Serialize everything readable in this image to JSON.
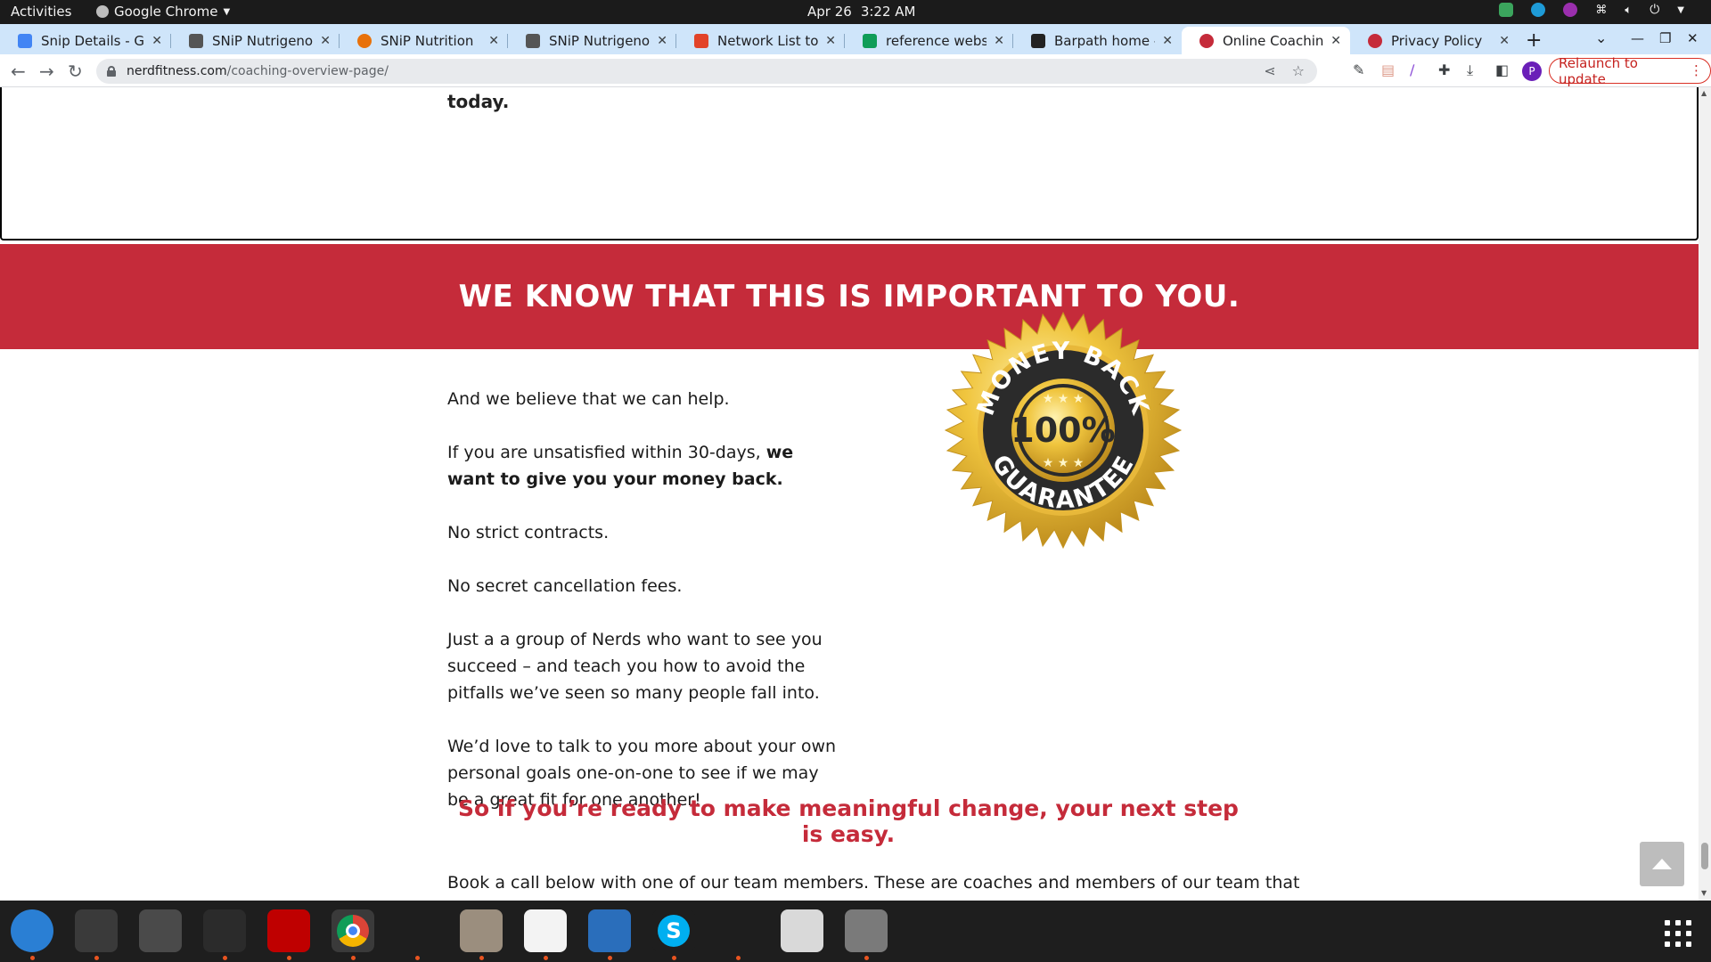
{
  "system": {
    "activities": "Activities",
    "app_name": "Google Chrome",
    "date": "Apr 26",
    "time": "3:22 AM"
  },
  "tabs": [
    {
      "label": "Snip Details - Goo",
      "color": "#4285f4"
    },
    {
      "label": "SNiP Nutrigenomi",
      "color": "#555555"
    },
    {
      "label": "SNiP Nutrition",
      "color": "#e8710a"
    },
    {
      "label": "SNiP Nutrigenomi",
      "color": "#555555"
    },
    {
      "label": "Network List to Ac",
      "color": "#e24329"
    },
    {
      "label": "reference website",
      "color": "#0f9d58"
    },
    {
      "label": "Barpath home - Ba",
      "color": "#222222"
    },
    {
      "label": "Online Coaching: ",
      "color": "#c52b3a"
    },
    {
      "label": "Privacy Policy",
      "color": "#c52b3a"
    }
  ],
  "omnibox": {
    "host": "nerdfitness.com",
    "path": "/coaching-overview-page/"
  },
  "relaunch_label": "Relaunch to update",
  "profile_initial": "P",
  "page": {
    "prev_tail": "today.",
    "banner": "WE KNOW THAT THIS IS IMPORTANT TO YOU.",
    "p1": "And we believe that we can help.",
    "p2_plain": "If you are unsatisfied within 30-days, ",
    "p2_bold": "we want to give you your money back.",
    "p3": "No strict contracts.",
    "p4": "No secret cancellation fees.",
    "p5": "Just a a group of Nerds who want to see you succeed – and teach you how to avoid the pitfalls we’ve seen so many people fall into.",
    "p6": "We’d love to talk to you more about your own personal goals one-on-one to see if we may be a great fit for one another!",
    "cta": "So if you’re ready to make meaningful change, your next step is easy.",
    "book": "Book a call below with one of our team members. These are coaches and members of our team that",
    "badge": {
      "top_text": "MONEY BACK",
      "center_text": "100%",
      "bottom_text": "GUARANTEE"
    }
  },
  "colors": {
    "brand_red": "#c52b3a",
    "tabstrip": "#cfe5fa",
    "gold": "#e9b330"
  },
  "dock_apps": [
    {
      "name": "thunderbird-icon",
      "color": "#2a7fd4"
    },
    {
      "name": "terminal-icon",
      "color": "#3a3a3a"
    },
    {
      "name": "calculator-icon",
      "color": "#4a4a4a"
    },
    {
      "name": "system-monitor-icon",
      "color": "#2b2b2b"
    },
    {
      "name": "filezilla-icon",
      "color": "#bf0000"
    },
    {
      "name": "chrome-icon",
      "color": "#3a3a3a"
    },
    {
      "name": "vscode-icon",
      "color": "#1e1e1e"
    },
    {
      "name": "files-icon",
      "color": "#9b8e7e"
    },
    {
      "name": "text-editor-icon",
      "color": "#f3f3f3"
    },
    {
      "name": "libreoffice-writer-icon",
      "color": "#2a6ebb"
    },
    {
      "name": "skype-icon",
      "color": "#1e1e1e"
    },
    {
      "name": "blender-like-icon",
      "color": "#1e1e1e"
    },
    {
      "name": "image-viewer-icon",
      "color": "#d9d9d9"
    },
    {
      "name": "disks-icon",
      "color": "#7a7a7a"
    }
  ]
}
